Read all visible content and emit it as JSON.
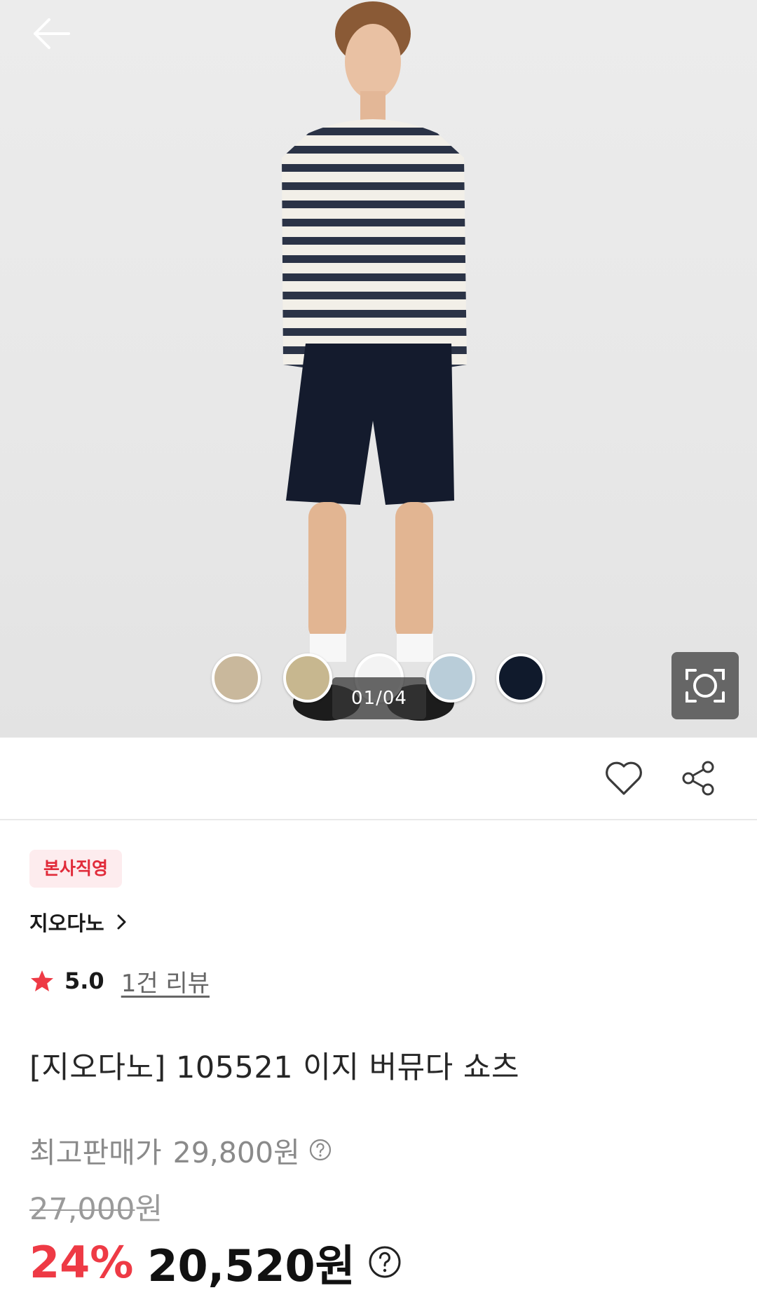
{
  "hero": {
    "back_icon": "arrow-left-icon",
    "image_counter": "01/04",
    "scan_icon": "camera-scan-icon",
    "swatch_colors": [
      "#c9b89c",
      "#c7b78f",
      "#f3f3f3",
      "#b9cdd9",
      "#101a2c"
    ]
  },
  "actions": {
    "wishlist_icon": "heart-icon",
    "share_icon": "share-icon"
  },
  "product": {
    "badge": "본사직영",
    "brand": "지오다노",
    "rating": "5.0",
    "review_link": "1건 리뷰",
    "title": "[지오다노] 105521 이지 버뮤다 쇼츠",
    "highest_price_label": "최고판매가",
    "highest_price": "29,800원",
    "original_price": "27,000",
    "original_price_unit": "원",
    "discount_rate": "24%",
    "final_price": "20,520원"
  },
  "colors": {
    "accent_red": "#ee3a45",
    "badge_bg": "#fdecee",
    "badge_text": "#e12b3a"
  }
}
